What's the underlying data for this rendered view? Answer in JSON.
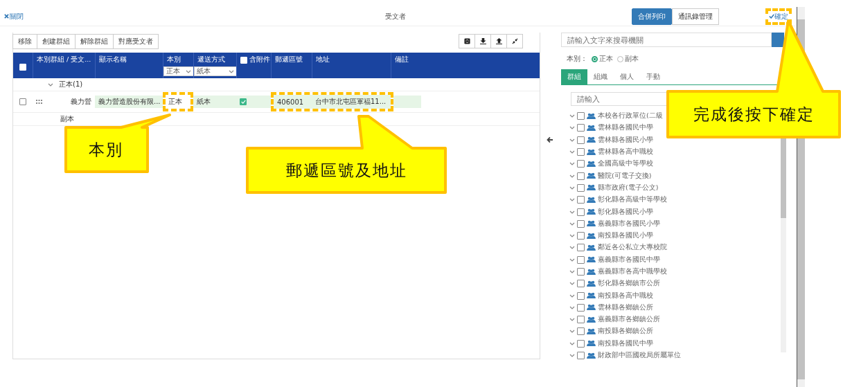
{
  "window": {
    "close_label": "關閉",
    "title": "受文者",
    "header_buttons": [
      {
        "label": "合併列印",
        "selected": true
      },
      {
        "label": "通訊錄管理",
        "selected": false
      }
    ],
    "confirm_label": "確定"
  },
  "toolbar": [
    "移除",
    "創建群組",
    "解除群組",
    "對應受文者"
  ],
  "table": {
    "select_all": false,
    "columns": [
      "本別群組 / 受文...",
      "顯示名稱",
      "本別",
      "遞送方式",
      "含附件",
      "郵遞區號",
      "地址",
      "備註"
    ],
    "attachment_header_checked": false,
    "filters": {
      "copy_type": "正本",
      "delivery": "紙本"
    },
    "groups": [
      {
        "label": "正本(1)",
        "expanded": true,
        "rows": [
          {
            "checked": false,
            "group": "義力營",
            "name": "義力營造股份有限...",
            "copy_type": "正本",
            "delivery": "紙本",
            "attachment": true,
            "postcode": "406001",
            "address": "台中市北屯區軍福11..."
          }
        ]
      },
      {
        "label": "副本"
      }
    ]
  },
  "right_panel": {
    "search_placeholder": "請輸入文字來搜尋機關",
    "copy_type_label": "本別：",
    "copy_types": [
      {
        "label": "正本",
        "selected": true
      },
      {
        "label": "副本",
        "selected": false
      }
    ],
    "tabs": [
      {
        "label": "群組",
        "selected": true
      },
      {
        "label": "組織",
        "selected": false
      },
      {
        "label": "個人",
        "selected": false
      },
      {
        "label": "手動",
        "selected": false
      }
    ],
    "tree_search_placeholder": "請輸入",
    "tree": [
      {
        "label": "本校各行政單位(二級",
        "checked": false
      },
      {
        "label": "雲林縣各國民中學",
        "checked": false
      },
      {
        "label": "雲林縣各國民小學",
        "checked": false
      },
      {
        "label": "雲林縣各高中職校",
        "checked": false
      },
      {
        "label": "全國高級中等學校",
        "checked": false
      },
      {
        "label": "醫院(可電子交換)",
        "checked": false
      },
      {
        "label": "縣市政府(電子公文)",
        "checked": false
      },
      {
        "label": "彰化縣各高級中等學校",
        "checked": false
      },
      {
        "label": "彰化縣各國民小學",
        "checked": false
      },
      {
        "label": "嘉義縣市各國民小學",
        "checked": false
      },
      {
        "label": "南投縣各國民小學",
        "checked": false
      },
      {
        "label": "鄰近各公私立大專校院",
        "checked": false
      },
      {
        "label": "嘉義縣市各國民中學",
        "checked": false
      },
      {
        "label": "嘉義縣市各高中職學校",
        "checked": false
      },
      {
        "label": "彰化縣各鄉鎮市公所",
        "checked": false
      },
      {
        "label": "南投縣各高中職校",
        "checked": false
      },
      {
        "label": "雲林縣各鄉鎮公所",
        "checked": false
      },
      {
        "label": "嘉義縣市各鄉鎮公所",
        "checked": false
      },
      {
        "label": "南投縣各鄉鎮公所",
        "checked": false
      },
      {
        "label": "南投縣各國民中學",
        "checked": false
      },
      {
        "label": "財政部中區國稅局所屬單位",
        "checked": false
      }
    ]
  },
  "callouts": [
    "本別",
    "郵遞區號及地址",
    "完成後按下確定"
  ]
}
